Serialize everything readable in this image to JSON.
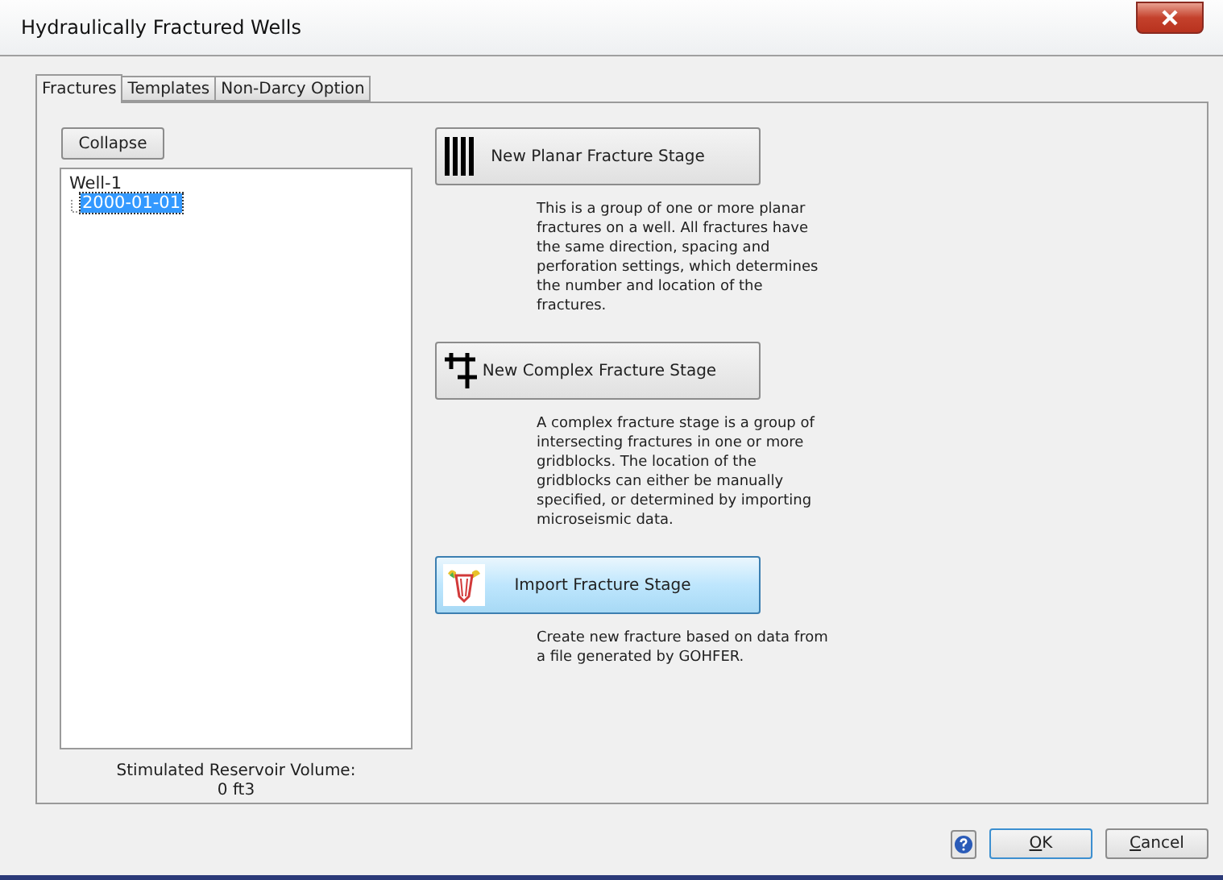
{
  "window": {
    "title": "Hydraulically Fractured Wells"
  },
  "tabs": [
    {
      "label": "Fractures",
      "selected": true
    },
    {
      "label": "Templates",
      "selected": false
    },
    {
      "label": "Non-Darcy Option",
      "selected": false
    }
  ],
  "collapse_button": "Collapse",
  "tree": [
    {
      "label": "Well-1",
      "selected": false,
      "children": [
        {
          "label": "2000-01-01",
          "selected": true
        }
      ]
    }
  ],
  "volume": {
    "label": "Stimulated Reservoir Volume:",
    "value": "0 ft3"
  },
  "stages": [
    {
      "kind": "planar",
      "label": "New Planar Fracture Stage",
      "highlighted": false,
      "description": "This is a group of one or more planar fractures on a well. All fractures have the same direction, spacing and perforation settings, which determines the number and location of the fractures."
    },
    {
      "kind": "complex",
      "label": "New Complex Fracture Stage",
      "highlighted": false,
      "description": "A complex fracture stage is a group of intersecting fractures in one or more gridblocks. The location of the gridblocks can either be manually specified, or determined by importing microseismic data."
    },
    {
      "kind": "import",
      "label": "Import Fracture Stage",
      "highlighted": true,
      "description": "Create new fracture based on data from a file generated by GOHFER."
    }
  ],
  "buttons": [
    {
      "label": "OK",
      "default": true
    },
    {
      "label": "Cancel",
      "default": false
    }
  ]
}
